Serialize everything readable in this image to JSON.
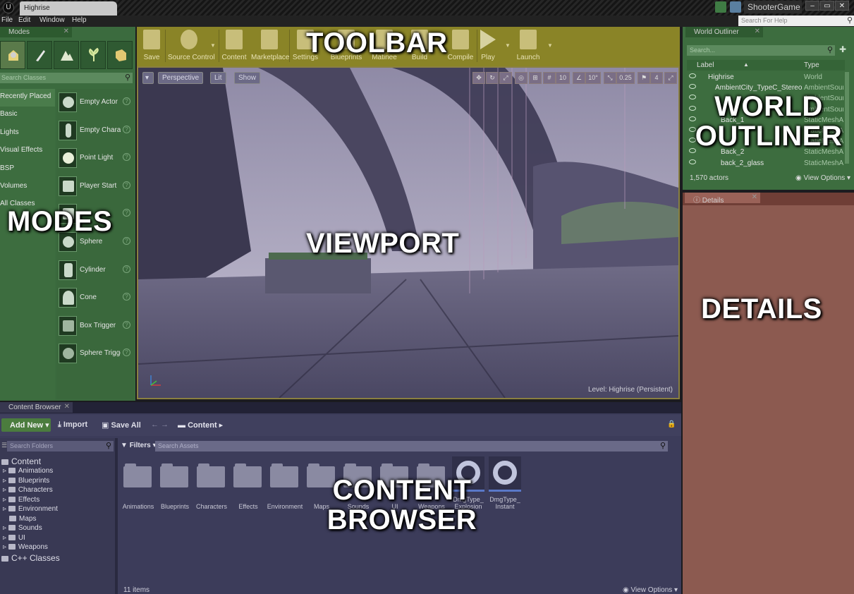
{
  "titlebar": {
    "tab_title": "Highrise",
    "logo": "U",
    "project": "ShooterGame",
    "window_buttons": [
      "–",
      "▭",
      "✕"
    ],
    "icons": [
      "comment-icon",
      "marketplace-icon"
    ]
  },
  "menu": {
    "items": [
      "File",
      "Edit",
      "Window",
      "Help"
    ],
    "help_search_placeholder": "Search For Help"
  },
  "overlays": {
    "modes": "MODES",
    "toolbar": "TOOLBAR",
    "viewport": "VIEWPORT",
    "outliner_line1": "WORLD",
    "outliner_line2": "OUTLINER",
    "details": "DETAILS",
    "content_line1": "CONTENT",
    "content_line2": "BROWSER"
  },
  "modes": {
    "tab_label": "Modes",
    "search_placeholder": "Search Classes",
    "categories": [
      "Recently Placed",
      "Basic",
      "Lights",
      "Visual Effects",
      "BSP",
      "Volumes",
      "All Classes"
    ],
    "classes": [
      "Empty Actor",
      "Empty Charac",
      "Point Light",
      "Player Start",
      "",
      "Sphere",
      "Cylinder",
      "Cone",
      "Box Trigger",
      "Sphere Trigge"
    ],
    "help_glyph": "?"
  },
  "toolbar": {
    "buttons": [
      "Save",
      "Source Control",
      "Content",
      "Marketplace",
      "Settings",
      "Blueprints",
      "Matinee",
      "Build",
      "Compile",
      "Play",
      "Launch"
    ]
  },
  "viewport": {
    "view_menu": "▾",
    "perspective": "Perspective",
    "lit": "Lit",
    "show": "Show",
    "grid_value": "10",
    "rot_value": "10°",
    "scale_value": "0.25",
    "cam_speed": "4",
    "level_label": "Level:",
    "level_name": "Highrise (Persistent)"
  },
  "outliner": {
    "tab_label": "World Outliner",
    "search_placeholder": "Search...",
    "col_label": "Label",
    "col_type": "Type",
    "rows": [
      {
        "name": "Highrise",
        "type": "World"
      },
      {
        "name": "AmbientCity_TypeC_Stereo",
        "type": "AmbientSound"
      },
      {
        "name": "",
        "type": "AmbientSound"
      },
      {
        "name": "",
        "type": "AmbientSound"
      },
      {
        "name": "Back_1",
        "type": "StaticMeshActo"
      },
      {
        "name": "",
        "type": "StaticMeshActo"
      },
      {
        "name": "",
        "type": "StaticMeshActo"
      },
      {
        "name": "Back_2",
        "type": "StaticMeshActo"
      },
      {
        "name": "back_2_glass",
        "type": "StaticMeshActo"
      }
    ],
    "actor_count": "1,570 actors",
    "view_options": "View Options"
  },
  "details": {
    "tab_label": "Details"
  },
  "content_browser": {
    "tab_label": "Content Browser",
    "add_new": "Add New",
    "import": "Import",
    "save_all": "Save All",
    "path": "Content",
    "folder_search_placeholder": "Search Folders",
    "filters": "Filters",
    "asset_search_placeholder": "Search Assets",
    "tree_root": "Content",
    "tree": [
      "Animations",
      "Blueprints",
      "Characters",
      "Effects",
      "Environment",
      "Maps",
      "Sounds",
      "UI",
      "Weapons"
    ],
    "cpp_classes": "C++ Classes",
    "assets": [
      {
        "name": "Animations",
        "kind": "folder"
      },
      {
        "name": "Blueprints",
        "kind": "folder"
      },
      {
        "name": "Characters",
        "kind": "folder"
      },
      {
        "name": "Effects",
        "kind": "folder"
      },
      {
        "name": "Environment",
        "kind": "folder"
      },
      {
        "name": "Maps",
        "kind": "folder"
      },
      {
        "name": "Sounds",
        "kind": "folder"
      },
      {
        "name": "UI",
        "kind": "folder"
      },
      {
        "name": "Weapons",
        "kind": "folder"
      },
      {
        "name": "DmgType_ Explosion",
        "kind": "damage-type"
      },
      {
        "name": "DmgType_ Instant",
        "kind": "damage-type"
      }
    ],
    "item_count": "11 items",
    "view_options": "View Options"
  },
  "colors": {
    "modes_panel": "#3b6b3e",
    "toolbar": "#8a8427",
    "details": "#8c5a50",
    "content_browser": "#3c3c5a",
    "viewport": "#3f3d5a"
  }
}
